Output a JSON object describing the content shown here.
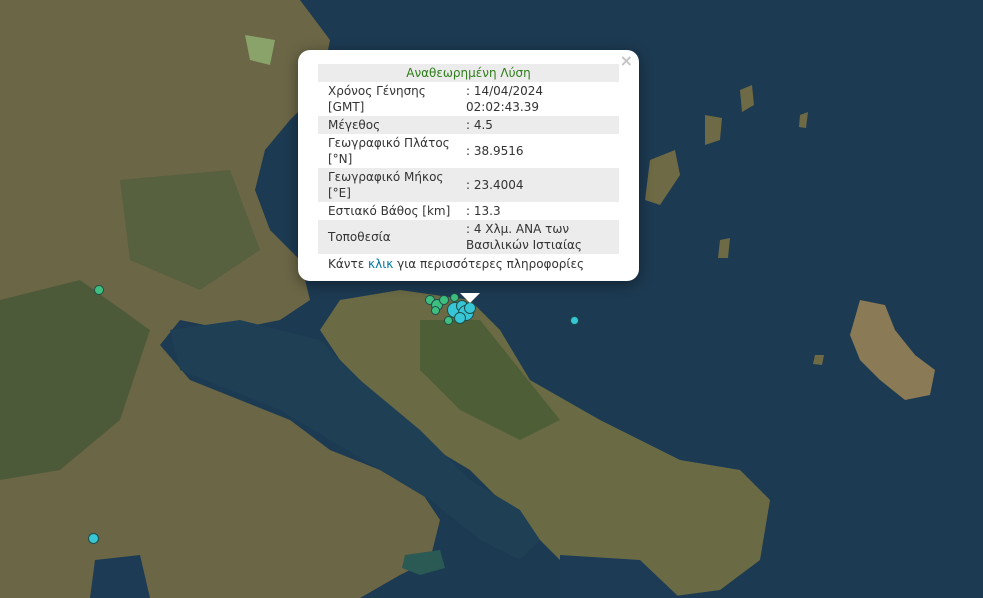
{
  "map": {
    "sea_color": "#1c3a52",
    "land_color": "#6b6646"
  },
  "markers": {
    "green_color": "#3fbf7f",
    "cyan_color": "#37c6d6",
    "items": [
      {
        "color": "green"
      },
      {
        "color": "green"
      },
      {
        "color": "green"
      },
      {
        "color": "green"
      },
      {
        "color": "green"
      },
      {
        "color": "green"
      },
      {
        "color": "cyan"
      },
      {
        "color": "cyan"
      },
      {
        "color": "cyan"
      },
      {
        "color": "cyan"
      },
      {
        "color": "cyan"
      },
      {
        "color": "green"
      },
      {
        "color": "cyan"
      },
      {
        "color": "cyan"
      }
    ]
  },
  "popup": {
    "close_icon": "×",
    "header": "Αναθεωρημένη Λύση",
    "rows": [
      {
        "label": "Χρόνος Γένησης [GMT]",
        "value": ": 14/04/2024 02:02:43.39"
      },
      {
        "label": "Μέγεθος",
        "value": ": 4.5"
      },
      {
        "label": "Γεωγραφικό Πλάτος [°N]",
        "value": ": 38.9516"
      },
      {
        "label": "Γεωγραφικό Μήκος [°E]",
        "value": ": 23.4004"
      },
      {
        "label": "Εστιακό Βάθος [km]",
        "value": ": 13.3"
      },
      {
        "label": "Τοποθεσία",
        "value": ": 4 Χλμ. ΑΝΑ των Βασιλικών Ιστιαίας"
      }
    ],
    "footer_prefix": "Κάντε ",
    "footer_link": "κλικ",
    "footer_suffix": " για περισσότερες πληροφορίες"
  }
}
